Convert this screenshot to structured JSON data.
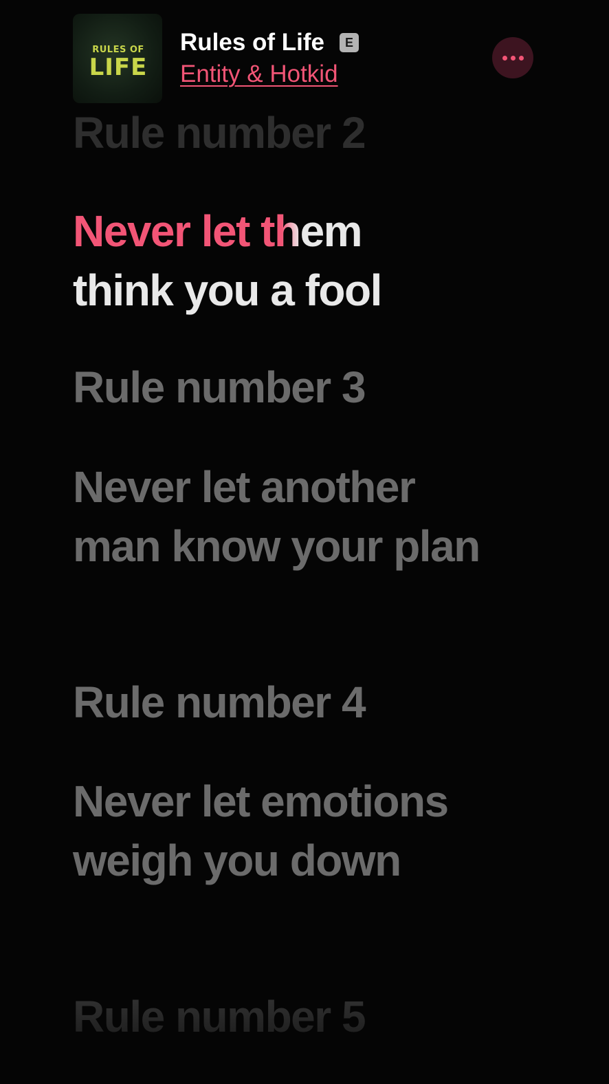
{
  "header": {
    "artwork": {
      "name": "album-artwork",
      "line1": "RULES OF",
      "line2": "LIFE"
    },
    "title": "Rules of Life",
    "explicit_badge": "E",
    "artist": "Entity & Hotkid",
    "more_icon": "ellipsis-icon"
  },
  "colors": {
    "accent": "#f25576",
    "background": "#050505",
    "active_text": "#e9e9e9",
    "dim_text": "#6b6b6b"
  },
  "lyrics": {
    "line_0": "Rule number 2",
    "line_1": {
      "sung": "Never let t",
      "partial": "h",
      "rest": "em think you a fool"
    },
    "line_2": "Rule number 3",
    "line_3": "Never let another man know your plan",
    "line_4": "Rule number 4",
    "line_5": "Never let emotions weigh you down",
    "line_6": "Rule number 5"
  }
}
